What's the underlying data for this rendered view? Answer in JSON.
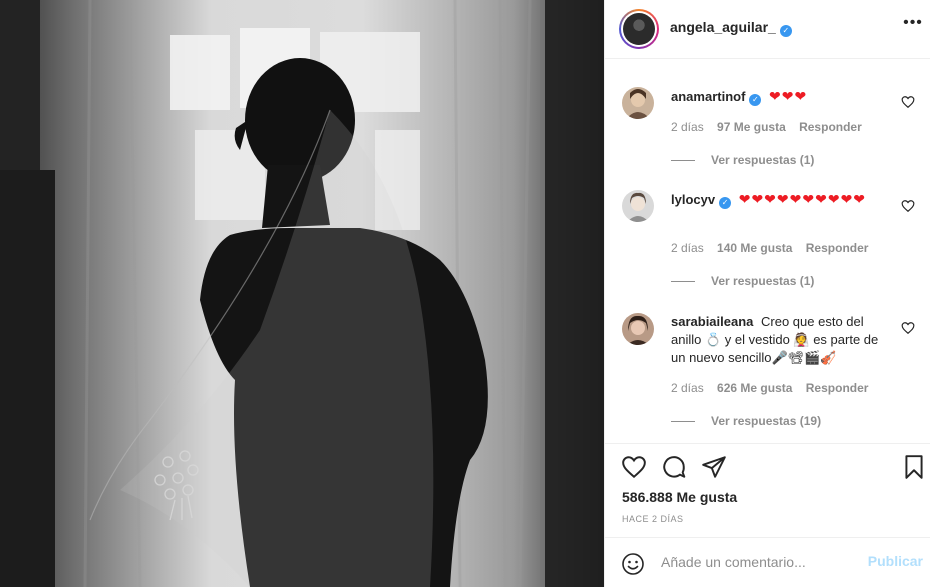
{
  "post": {
    "username": "angela_aguilar_",
    "verified": true,
    "more_icon": "more-horizontal-icon"
  },
  "comments": [
    {
      "username": "anamartinof",
      "verified": true,
      "text": "❤❤❤",
      "time": "2 días",
      "likes": "97 Me gusta",
      "reply": "Responder",
      "view_replies": "Ver respuestas (1)"
    },
    {
      "username": "lylocyv",
      "verified": true,
      "text": "❤❤❤❤❤❤❤❤❤❤",
      "time": "2 días",
      "likes": "140 Me gusta",
      "reply": "Responder",
      "view_replies": "Ver respuestas (1)"
    },
    {
      "username": "sarabiaileana",
      "verified": false,
      "text": "Creo que esto del anillo 💍 y el vestido 👰 es parte de un nuevo sencillo🎤📽🎬🎻",
      "time": "2 días",
      "likes": "626 Me gusta",
      "reply": "Responder",
      "view_replies": "Ver respuestas (19)"
    }
  ],
  "actions": {
    "likes_count": "586.888 Me gusta",
    "time_ago": "HACE 2 DÍAS",
    "icons": [
      "heart-icon",
      "comment-icon",
      "share-icon",
      "bookmark-icon"
    ]
  },
  "add_comment": {
    "placeholder": "Añade un comentario...",
    "publish_label": "Publicar",
    "emoji_icon": "emoji-icon"
  },
  "colors": {
    "link_disabled": "#b2dffc",
    "verified": "#3897f0",
    "heart_red": "#ed1c24",
    "meta_gray": "#8e8e8e"
  }
}
